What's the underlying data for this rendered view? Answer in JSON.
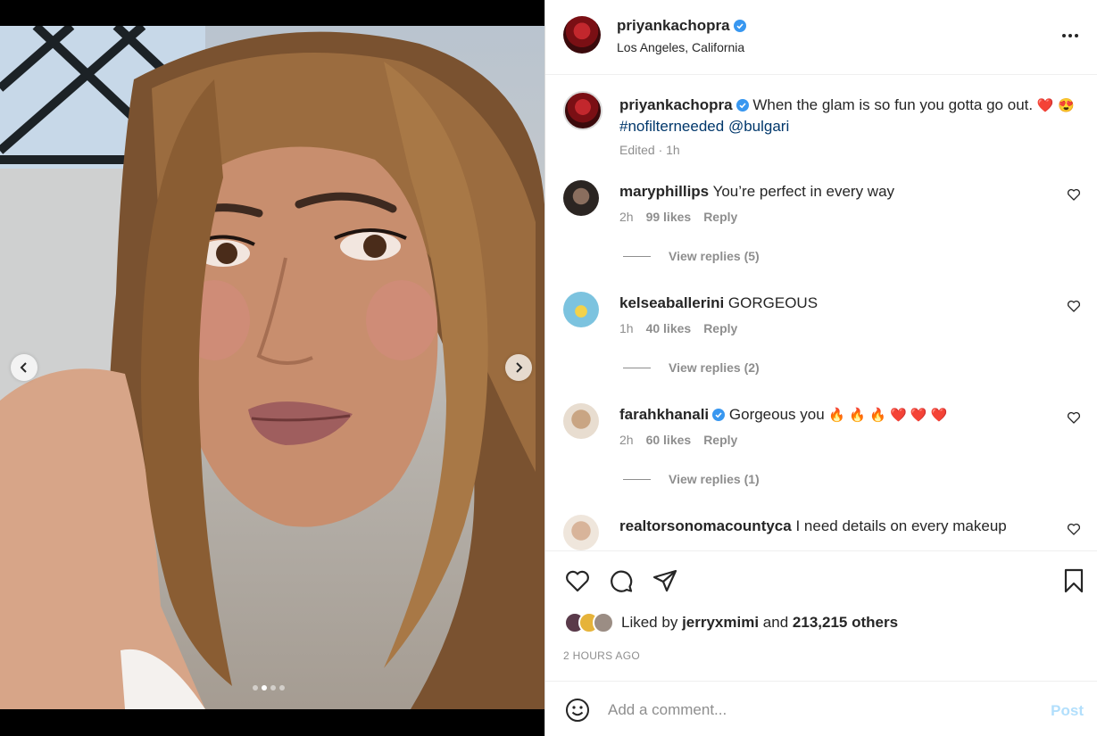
{
  "post": {
    "username": "priyankachopra",
    "location": "Los Angeles, California",
    "caption_text": "When the glam is so fun you gotta go out.",
    "caption_emoji_1": "❤️",
    "caption_emoji_2": "😍",
    "caption_hashtag": "#nofilterneeded",
    "caption_mention": "@bulgari",
    "caption_meta": "Edited · 1h"
  },
  "carousel": {
    "slide_count": 4,
    "active_slide": 2
  },
  "comments": [
    {
      "username": "maryphillips",
      "text": "You’re perfect in every way",
      "time": "2h",
      "likes": "99 likes",
      "reply_label": "Reply",
      "view_replies": "View replies (5)",
      "avatar_color": "#2b2522"
    },
    {
      "username": "kelseaballerini",
      "text": "GORGEOUS",
      "time": "1h",
      "likes": "40 likes",
      "reply_label": "Reply",
      "view_replies": "View replies (2)",
      "avatar_color": "#5fb8d6"
    },
    {
      "username": "farahkhanali",
      "text": "Gorgeous you",
      "emojis": "🔥 🔥 🔥 ❤️ ❤️ ❤️",
      "time": "2h",
      "likes": "60 likes",
      "reply_label": "Reply",
      "view_replies": "View replies (1)",
      "avatar_color": "#c9a583"
    },
    {
      "username": "realtorsonomacountyca",
      "text": "I need details on every makeup",
      "avatar_color": "#d8b49a"
    }
  ],
  "engagement": {
    "liked_by_prefix": "Liked by",
    "liked_by_user": "jerryxmimi",
    "liked_by_and": "and",
    "liked_by_others": "213,215 others",
    "timestamp": "2 HOURS AGO"
  },
  "composer": {
    "placeholder": "Add a comment...",
    "post_label": "Post"
  },
  "colors": {
    "verified": "#3897f0",
    "link": "#00376b",
    "muted": "#8e8e8e",
    "post_disabled": "#b2dffc"
  },
  "icons": [
    "chevron-left-icon",
    "chevron-right-icon",
    "more-icon",
    "verified-icon",
    "heart-icon",
    "comment-icon",
    "share-icon",
    "bookmark-icon",
    "emoji-icon"
  ]
}
